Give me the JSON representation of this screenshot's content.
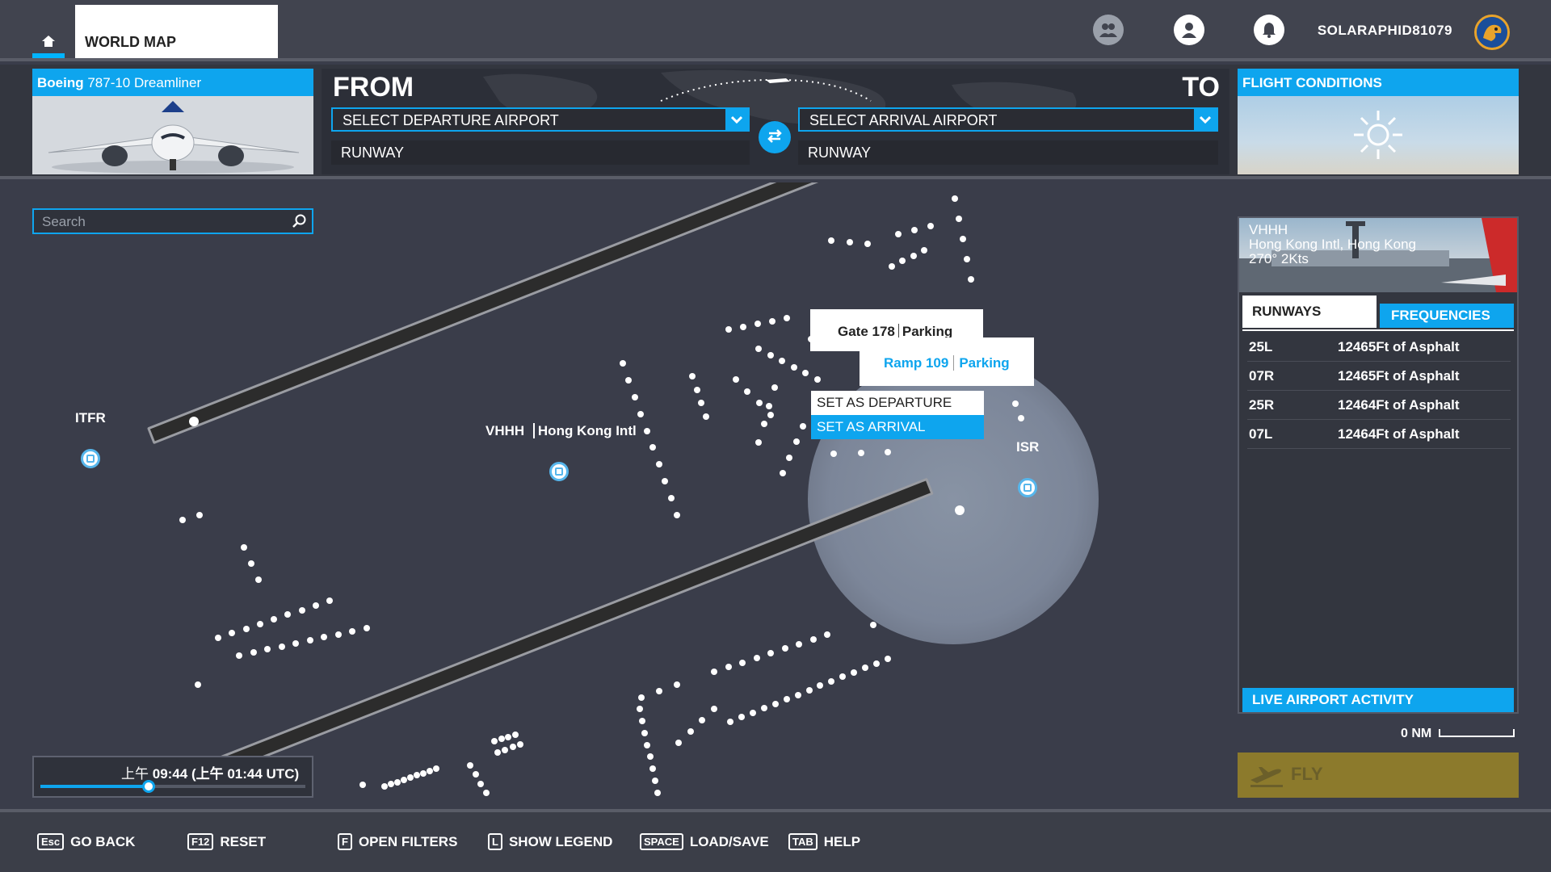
{
  "topbar": {
    "home_icon": "home-icon",
    "tab_world_map": "WORLD MAP",
    "friends_icon": "friends-icon",
    "profile_icon": "profile-icon",
    "notifications_icon": "bell-icon",
    "username": "SOLARAPHID81079"
  },
  "aircraft": {
    "brand": "Boeing",
    "model": " 787-10 Dreamliner"
  },
  "route": {
    "from_label": "FROM",
    "to_label": "TO",
    "departure_select": "SELECT DEPARTURE AIRPORT",
    "arrival_select": "SELECT ARRIVAL AIRPORT",
    "departure_runway": "RUNWAY",
    "arrival_runway": "RUNWAY",
    "swap_icon": "swap-icon"
  },
  "conditions": {
    "title": "FLIGHT CONDITIONS",
    "weather_icon": "sun-icon"
  },
  "search": {
    "placeholder": "Search",
    "icon": "search-icon"
  },
  "map": {
    "labels": {
      "itfr": "ITFR",
      "vhhh_code": "VHHH",
      "vhhh_name": "Hong Kong Intl",
      "isr": "ISR"
    },
    "popup_gate": {
      "name": "Gate 178",
      "type": "Parking"
    },
    "popup_ramp": {
      "name": "Ramp 109",
      "type": "Parking"
    },
    "context_menu": {
      "set_departure": "SET AS DEPARTURE",
      "set_arrival": "SET AS ARRIVAL"
    }
  },
  "time": {
    "local_prefix": "上午 ",
    "local_time": "09:44",
    "utc_text": " (上午 01:44 UTC)",
    "slider_position": 0.41
  },
  "airport_info": {
    "code": "VHHH",
    "name": "Hong Kong Intl, Hong Kong",
    "wind": "270° 2Kts",
    "tab_runways": "RUNWAYS",
    "tab_frequencies": "FREQUENCIES",
    "runways": [
      {
        "id": "25L",
        "info": "12465Ft of Asphalt"
      },
      {
        "id": "07R",
        "info": "12465Ft of Asphalt"
      },
      {
        "id": "25R",
        "info": "12464Ft of Asphalt"
      },
      {
        "id": "07L",
        "info": "12464Ft of Asphalt"
      }
    ],
    "live_activity": "LIVE AIRPORT ACTIVITY"
  },
  "scale_label": "0 NM",
  "fly_button": "FLY",
  "bottom_actions": [
    {
      "key": "Esc",
      "label": "GO BACK"
    },
    {
      "key": "F12",
      "label": "RESET"
    },
    {
      "key": "F",
      "label": "OPEN FILTERS"
    },
    {
      "key": "L",
      "label": "SHOW LEGEND"
    },
    {
      "key": "SPACE",
      "label": "LOAD/SAVE"
    },
    {
      "key": "TAB",
      "label": "HELP"
    }
  ],
  "colors": {
    "accent": "#0ea5ee",
    "fly_button": "#8c7a2c",
    "map_background": "#3a3d4a"
  }
}
